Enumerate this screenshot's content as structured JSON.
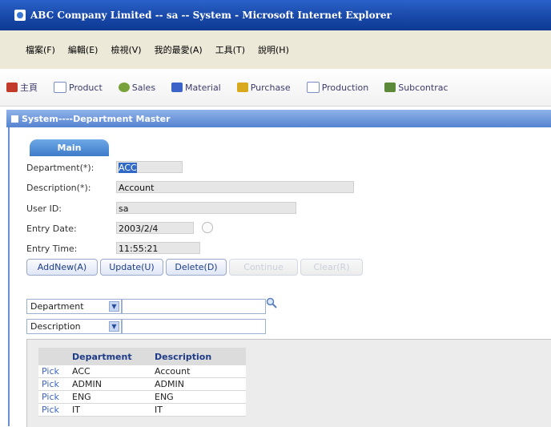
{
  "window": {
    "title": "ABC Company Limited -- sa -- System - Microsoft Internet Explorer"
  },
  "menu": [
    "檔案(F)",
    "編輯(E)",
    "檢視(V)",
    "我的最愛(A)",
    "工具(T)",
    "說明(H)"
  ],
  "tabs": [
    "主頁",
    "Product",
    "Sales",
    "Material",
    "Purchase",
    "Production",
    "Subcontrac"
  ],
  "section": {
    "title": "System----Department Master"
  },
  "form": {
    "tab_label": "Main",
    "department_label": "Department(*):",
    "department_value": "ACC",
    "description_label": "Description(*):",
    "description_value": "Account",
    "userid_label": "User ID:",
    "userid_value": "sa",
    "entrydate_label": "Entry Date:",
    "entrydate_value": "2003/2/4",
    "entrytime_label": "Entry Time:",
    "entrytime_value": "11:55:21"
  },
  "buttons": {
    "addnew": "AddNew(A)",
    "update": "Update(U)",
    "delete": "Delete(D)",
    "continue": "Continue",
    "clear": "Clear(R)"
  },
  "search": {
    "field1": "Department",
    "field2": "Description"
  },
  "table": {
    "headers": [
      "",
      "Department",
      "Description"
    ],
    "rows": [
      {
        "pick": "Pick",
        "department": "ACC",
        "description": "Account"
      },
      {
        "pick": "Pick",
        "department": "ADMIN",
        "description": "ADMIN"
      },
      {
        "pick": "Pick",
        "department": "ENG",
        "description": "ENG"
      },
      {
        "pick": "Pick",
        "department": "IT",
        "description": "IT"
      }
    ]
  },
  "colors": {
    "title_bar": "#1746a6",
    "section_header": "#5683d0",
    "tab_main": "#3d7bc9",
    "link": "#3a64c4"
  }
}
